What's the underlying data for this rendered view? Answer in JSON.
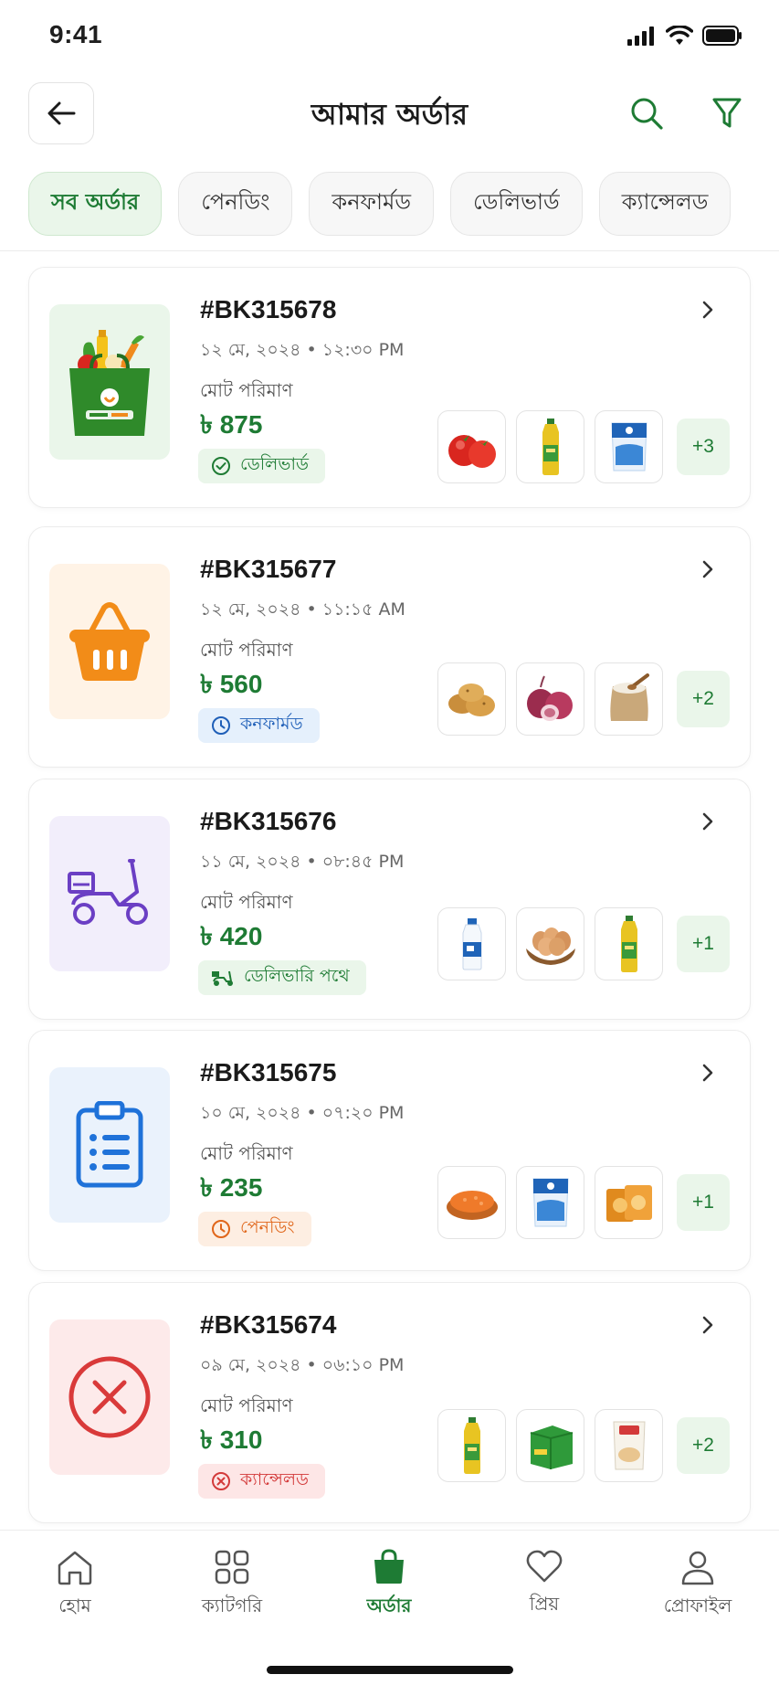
{
  "status_bar": {
    "time": "9:41"
  },
  "header": {
    "title": "আমার অর্ডার"
  },
  "tabs": [
    {
      "label": "সব অর্ডার",
      "active": true
    },
    {
      "label": "পেনডিং",
      "active": false
    },
    {
      "label": "কনফার্মড",
      "active": false
    },
    {
      "label": "ডেলিভার্ড",
      "active": false
    },
    {
      "label": "ক্যান্সেলড",
      "active": false
    }
  ],
  "orders": [
    {
      "id": "#BK315678",
      "date": "১২ মে, ২০২৪ • ১২:৩০ PM",
      "amount_label": "মোট পরিমাণ",
      "amount": "৳ 875",
      "status": "ডেলিভার্ড",
      "status_color": "#1e7b34",
      "badge_bg": "#eaf6ea",
      "thumb_icon": "grocery-bag-icon",
      "thumb_bg": "#eaf6ea",
      "products": [
        "tomato-icon",
        "oil-bottle-icon",
        "milk-pack-icon"
      ],
      "more": "+3"
    },
    {
      "id": "#BK315677",
      "date": "১২ মে, ২০২৪ • ১১:১৫ AM",
      "amount_label": "মোট পরিমাণ",
      "amount": "৳ 560",
      "status": "কনফার্মড",
      "status_color": "#1f5fb8",
      "badge_bg": "#e5f0fc",
      "thumb_icon": "basket-icon",
      "thumb_bg": "#fff3e6",
      "products": [
        "potato-icon",
        "onion-icon",
        "rice-sack-icon"
      ],
      "more": "+2"
    },
    {
      "id": "#BK315676",
      "date": "১১ মে, ২০২৪ • ০৮:৪৫ PM",
      "amount_label": "মোট পরিমাণ",
      "amount": "৳ 420",
      "status": "ডেলিভারি পথে",
      "status_color": "#1e7b34",
      "badge_bg": "#eaf6ea",
      "thumb_icon": "scooter-icon",
      "thumb_bg": "#f2eefb",
      "products": [
        "milk-bottle-icon",
        "eggs-icon",
        "oil-bottle-icon"
      ],
      "more": "+1"
    },
    {
      "id": "#BK315675",
      "date": "১০ মে, ২০২৪ • ০৭:২০ PM",
      "amount_label": "মোট পরিমাণ",
      "amount": "৳ 235",
      "status": "পেনডিং",
      "status_color": "#e0661a",
      "badge_bg": "#fdeee2",
      "thumb_icon": "clipboard-icon",
      "thumb_bg": "#eaf2fc",
      "products": [
        "lentils-icon",
        "milk-pack-icon",
        "biscuit-box-icon"
      ],
      "more": "+1"
    },
    {
      "id": "#BK315674",
      "date": "০৯ মে, ২০২৪ • ০৬:১০ PM",
      "amount_label": "মোট পরিমাণ",
      "amount": "৳ 310",
      "status": "ক্যান্সেলড",
      "status_color": "#d33a3a",
      "badge_bg": "#fde6e6",
      "thumb_icon": "cancel-circle-icon",
      "thumb_bg": "#fdeaea",
      "products": [
        "oil-bottle-icon",
        "tea-box-icon",
        "flour-pack-icon"
      ],
      "more": "+2"
    }
  ],
  "bottom_nav": [
    {
      "label": "হোম",
      "icon": "home-icon",
      "active": false
    },
    {
      "label": "ক্যাটগরি",
      "icon": "category-icon",
      "active": false
    },
    {
      "label": "অর্ডার",
      "icon": "shopping-bag-icon",
      "active": true
    },
    {
      "label": "প্রিয়",
      "icon": "heart-icon",
      "active": false
    },
    {
      "label": "প্রোফাইল",
      "icon": "profile-icon",
      "active": false
    }
  ],
  "colors": {
    "accent": "#1e7b34",
    "accent_light": "#eaf6ea"
  }
}
